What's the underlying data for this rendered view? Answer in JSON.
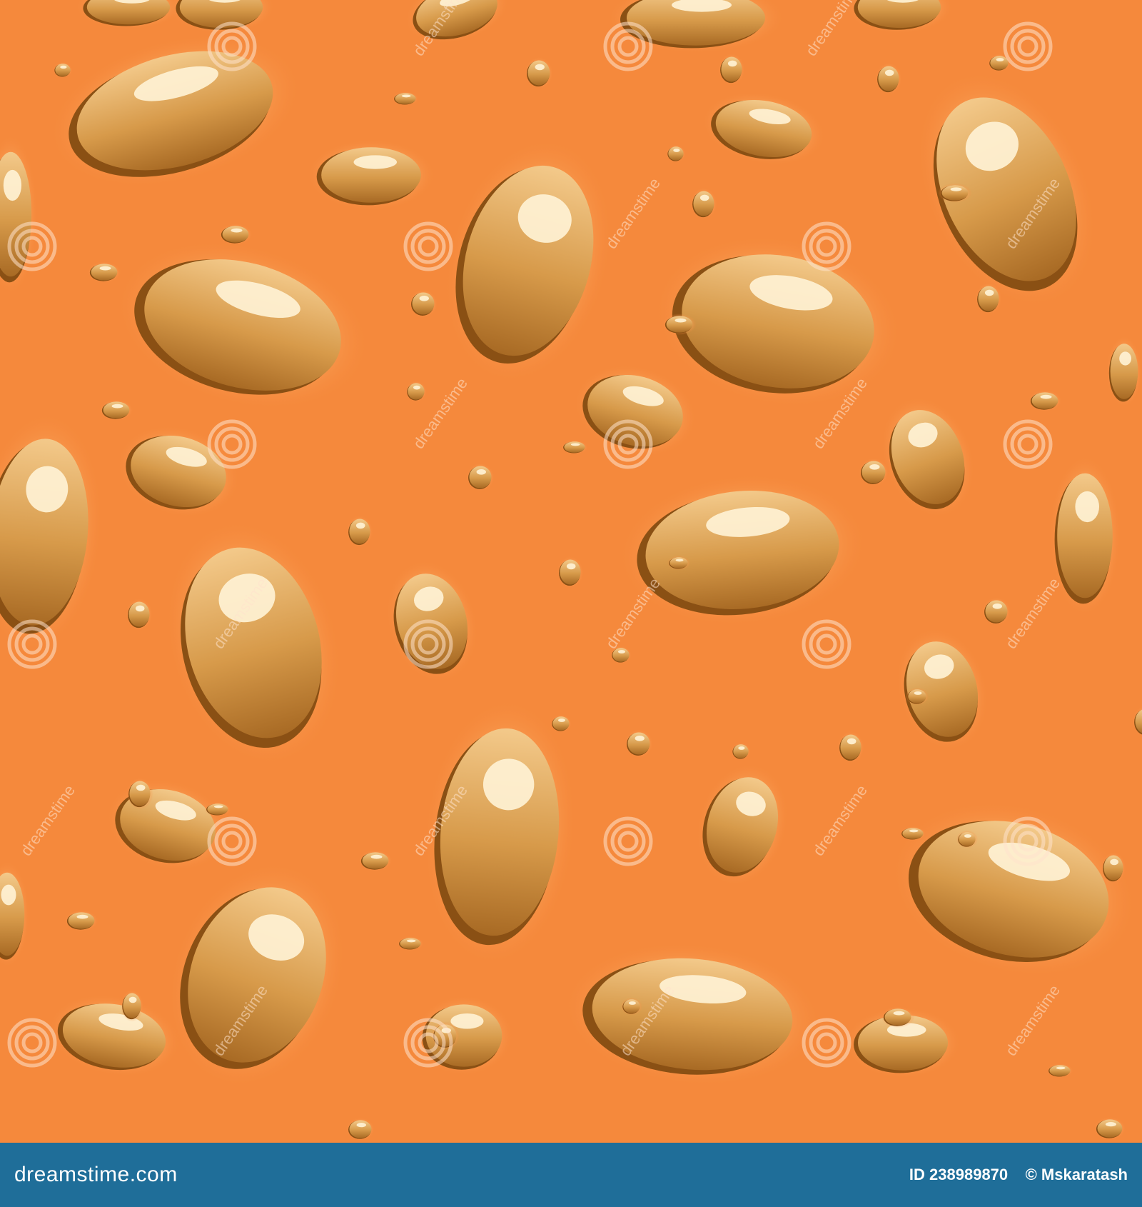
{
  "image": {
    "background_color": "#f5893c",
    "drop_color_top": "#f1c27a",
    "drop_color_bottom": "#a9691d",
    "drop_highlight": "#fff5da",
    "watermark_text": "dreamstime"
  },
  "footer": {
    "brand": "dreamstime.com",
    "image_id": "ID 238989870",
    "author": "© Mskaratash",
    "background_color": "#1f6e99"
  }
}
